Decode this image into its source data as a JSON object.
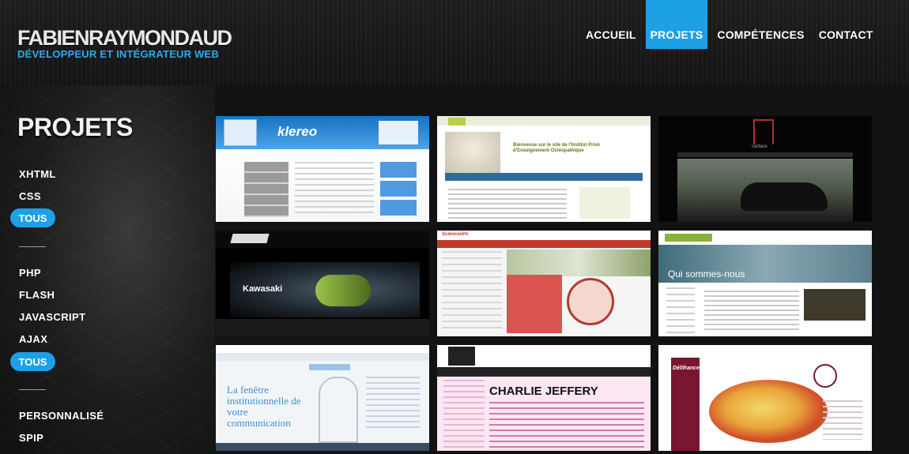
{
  "header": {
    "name": "FABIENRAYMONDAUD",
    "tagline": "DÉVELOPPEUR ET INTÉGRATEUR WEB"
  },
  "nav": {
    "items": [
      {
        "label": "ACCUEIL",
        "active": false
      },
      {
        "label": "PROJETS",
        "active": true
      },
      {
        "label": "COMPÉTENCES",
        "active": false
      },
      {
        "label": "CONTACT",
        "active": false
      }
    ]
  },
  "sidebar": {
    "title": "PROJETS",
    "group1": [
      "XHTML",
      "CSS"
    ],
    "group1_active": "TOUS",
    "group2": [
      "PHP",
      "FLASH",
      "JAVASCRIPT",
      "AJAX"
    ],
    "group2_active": "TOUS",
    "group3": [
      "PERSONNALISÉ",
      "SPIP"
    ]
  },
  "projects": [
    {
      "caption": "klereo",
      "accent": "#1a86d0"
    },
    {
      "caption": "Bienvenue sur le site de l'Institut Privé d'Enseignement Ostéopathique",
      "accent": "#8dbb2a"
    },
    {
      "caption": "carface",
      "accent": "#aa2222"
    },
    {
      "caption": "Kawasaki",
      "accent": "#7aa53a"
    },
    {
      "caption": "SciencesPo",
      "accent": "#c0392b"
    },
    {
      "caption": "Qui sommes-nous",
      "accent": "#86b438"
    },
    {
      "caption": "La fenêtre institutionnelle de votre communication",
      "accent": "#3a8fd0"
    },
    {
      "caption": "CHARLIE JEFFERY",
      "accent": "#e060a8"
    },
    {
      "caption": "Délifrance",
      "accent": "#7a1630"
    }
  ]
}
